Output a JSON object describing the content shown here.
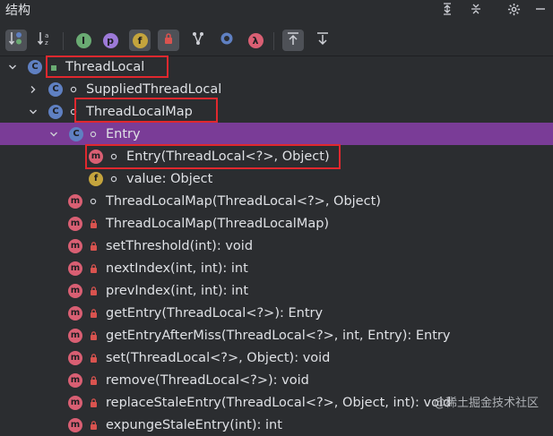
{
  "panel": {
    "title": "结构"
  },
  "toolbar": {
    "buttons": [
      {
        "name": "sort-by-type",
        "icon": "sort-type-icon"
      },
      {
        "name": "sort-alphabetically",
        "icon": "sort-alpha-icon"
      },
      {
        "name": "show-inherited",
        "icon": "inherited-icon",
        "glyph": "I"
      },
      {
        "name": "show-properties",
        "icon": "property-icon",
        "glyph": "p"
      },
      {
        "name": "show-fields",
        "icon": "field-icon",
        "glyph": "f"
      },
      {
        "name": "show-non-public",
        "icon": "lock-icon"
      },
      {
        "name": "show-anonymous",
        "icon": "branch-icon"
      },
      {
        "name": "show-modules",
        "icon": "circle-icon"
      },
      {
        "name": "show-lambdas",
        "icon": "lambda-icon",
        "glyph": "λ"
      },
      {
        "name": "autoscroll-to-source",
        "icon": "scroll-to-icon"
      },
      {
        "name": "autoscroll-from-source",
        "icon": "scroll-from-icon"
      }
    ]
  },
  "tree": {
    "nodes": [
      {
        "label": "ThreadLocal",
        "kind": "class"
      },
      {
        "label": "SuppliedThreadLocal",
        "kind": "class"
      },
      {
        "label": "ThreadLocalMap",
        "kind": "class"
      },
      {
        "label": "Entry",
        "kind": "class"
      },
      {
        "label": "Entry(ThreadLocal<?>, Object)",
        "kind": "method"
      },
      {
        "label": "value: Object",
        "kind": "field"
      },
      {
        "label": "ThreadLocalMap(ThreadLocal<?>, Object)",
        "kind": "method"
      },
      {
        "label": "ThreadLocalMap(ThreadLocalMap)",
        "kind": "method"
      },
      {
        "label": "setThreshold(int): void",
        "kind": "method"
      },
      {
        "label": "nextIndex(int, int): int",
        "kind": "method"
      },
      {
        "label": "prevIndex(int, int): int",
        "kind": "method"
      },
      {
        "label": "getEntry(ThreadLocal<?>): Entry",
        "kind": "method"
      },
      {
        "label": "getEntryAfterMiss(ThreadLocal<?>, int, Entry): Entry",
        "kind": "method"
      },
      {
        "label": "set(ThreadLocal<?>, Object): void",
        "kind": "method"
      },
      {
        "label": "remove(ThreadLocal<?>): void",
        "kind": "method"
      },
      {
        "label": "replaceStaleEntry(ThreadLocal<?>, Object, int): void",
        "kind": "method"
      },
      {
        "label": "expungeStaleEntry(int): int",
        "kind": "method"
      }
    ]
  },
  "watermark": "@稀土掘金技术社区",
  "colors": {
    "selection": "#7a3c97",
    "highlight_box": "#e0282e",
    "class_icon": "#5f80c2",
    "method_icon": "#d95f73",
    "field_icon": "#c4a43d",
    "lock": "#d9534f"
  }
}
